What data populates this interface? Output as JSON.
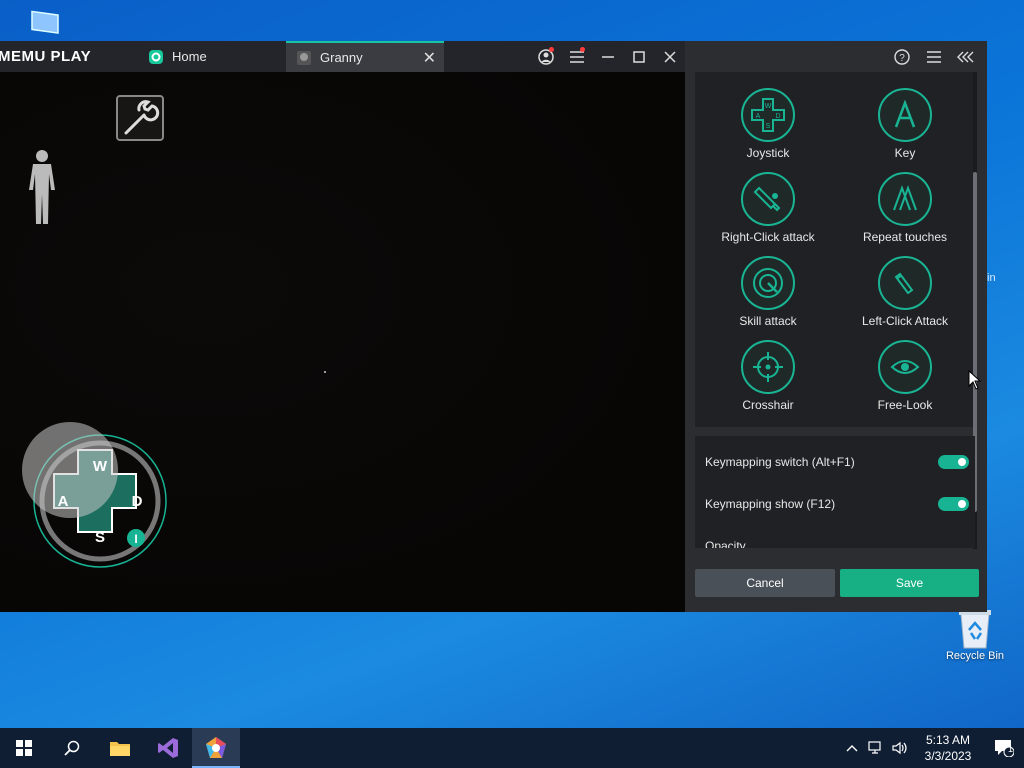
{
  "emulator": {
    "brand": "MEMU PLAY",
    "tabs": [
      {
        "label": "Home"
      },
      {
        "label": "Granny"
      }
    ]
  },
  "keymap_panel": {
    "tools": [
      {
        "label": "Joystick",
        "icon": "joystick-icon"
      },
      {
        "label": "Key",
        "icon": "key-icon"
      },
      {
        "label": "Right-Click attack",
        "icon": "right-click-attack-icon"
      },
      {
        "label": "Repeat touches",
        "icon": "repeat-touches-icon"
      },
      {
        "label": "Skill attack",
        "icon": "skill-attack-icon"
      },
      {
        "label": "Left-Click Attack",
        "icon": "left-click-attack-icon"
      },
      {
        "label": "Crosshair",
        "icon": "crosshair-icon"
      },
      {
        "label": "Free-Look",
        "icon": "eye-icon"
      }
    ],
    "settings": [
      {
        "label": "Keymapping switch (Alt+F1)",
        "enabled": true
      },
      {
        "label": "Keymapping show (F12)",
        "enabled": true
      },
      {
        "label": "Opacity"
      }
    ],
    "cancel_label": "Cancel",
    "save_label": "Save"
  },
  "dpad": {
    "up": "W",
    "left": "A",
    "right": "D",
    "down": "S",
    "extra": "I"
  },
  "desktop": {
    "recycle_bin_label": "Recycle Bin",
    "partial_label": "in"
  },
  "taskbar": {
    "time": "5:13 AM",
    "date": "3/3/2023",
    "notification_count": "1"
  },
  "colors": {
    "accent": "#17b393",
    "panel": "#2b2d31",
    "taskbar": "#0f1e33"
  }
}
